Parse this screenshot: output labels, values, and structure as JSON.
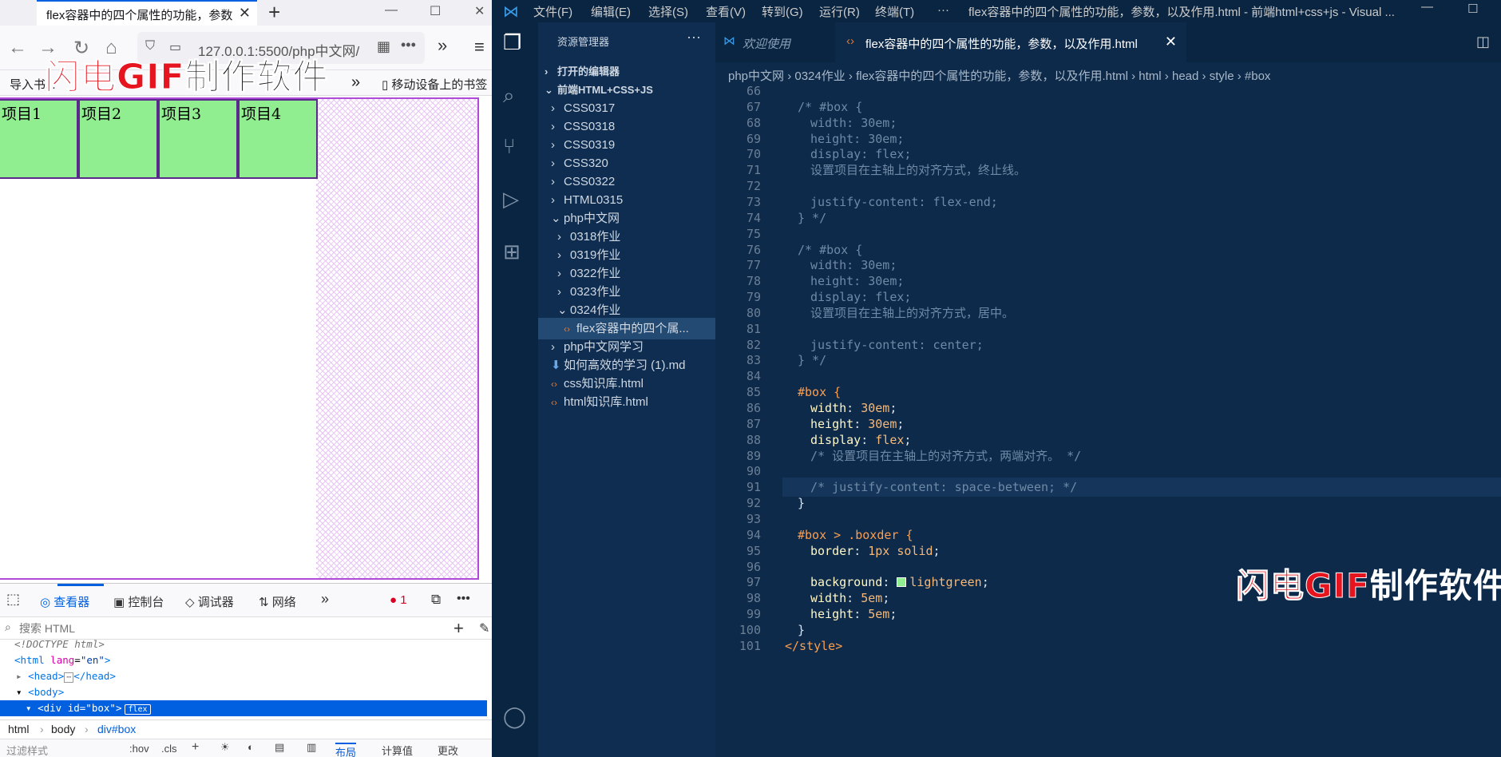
{
  "browser": {
    "tab_title": "flex容器中的四个属性的功能，参数",
    "tab_close": "✕",
    "new_tab": "+",
    "url": "127.0.0.1:5500/php中文网/",
    "bookmarks_more": "»",
    "bookmark_mobile": "移动设备上的书签",
    "bookmarks_partial": "导入书...",
    "items": [
      "项目1",
      "项目2",
      "项目3",
      "项目4"
    ]
  },
  "watermark": {
    "part1": "闪电GIF",
    "part2": "制作软件"
  },
  "devtools": {
    "tabs": [
      "查看器",
      "控制台",
      "调试器",
      "网络"
    ],
    "error_count": "1",
    "search_placeholder": "搜索 HTML",
    "tree": {
      "doctype": "<!DOCTYPE html>",
      "html_tag": "html",
      "html_attr": "lang",
      "html_val": "\"en\"",
      "head": "head",
      "body": "body",
      "div_tag": "div",
      "div_attr": "id",
      "div_val": "\"box\"",
      "flex_badge": "flex"
    },
    "crumbs": [
      "html",
      "body",
      "div#box"
    ],
    "bottom": {
      "filter": "过滤样式",
      "hov": ":hov",
      "cls": ".cls",
      "layout": "布局",
      "computed": "计算值",
      "changes": "更改"
    }
  },
  "vscode": {
    "menus": [
      "文件(F)",
      "编辑(E)",
      "选择(S)",
      "查看(V)",
      "转到(G)",
      "运行(R)",
      "终端(T)",
      "···"
    ],
    "title": "flex容器中的四个属性的功能，参数，以及作用.html - 前端html+css+js - Visual ...",
    "sidebar": {
      "header": "资源管理器",
      "sec_open": "打开的编辑器",
      "sec_project": "前端HTML+CSS+JS",
      "items": [
        {
          "label": "CSS0317",
          "depth": 1,
          "kind": "folder",
          "open": false
        },
        {
          "label": "CSS0318",
          "depth": 1,
          "kind": "folder",
          "open": false
        },
        {
          "label": "CSS0319",
          "depth": 1,
          "kind": "folder",
          "open": false
        },
        {
          "label": "CSS320",
          "depth": 1,
          "kind": "folder",
          "open": false
        },
        {
          "label": "CSS0322",
          "depth": 1,
          "kind": "folder",
          "open": false
        },
        {
          "label": "HTML0315",
          "depth": 1,
          "kind": "folder",
          "open": false
        },
        {
          "label": "php中文网",
          "depth": 1,
          "kind": "folder",
          "open": true
        },
        {
          "label": "0318作业",
          "depth": 2,
          "kind": "folder",
          "open": false
        },
        {
          "label": "0319作业",
          "depth": 2,
          "kind": "folder",
          "open": false
        },
        {
          "label": "0322作业",
          "depth": 2,
          "kind": "folder",
          "open": false
        },
        {
          "label": "0323作业",
          "depth": 2,
          "kind": "folder",
          "open": false
        },
        {
          "label": "0324作业",
          "depth": 2,
          "kind": "folder",
          "open": true
        },
        {
          "label": "flex容器中的四个属...",
          "depth": 3,
          "kind": "html",
          "active": true
        },
        {
          "label": "php中文网学习",
          "depth": 1,
          "kind": "folder",
          "open": false
        },
        {
          "label": "如何高效的学习 (1).md",
          "depth": 1,
          "kind": "md"
        },
        {
          "label": "css知识库.html",
          "depth": 1,
          "kind": "html"
        },
        {
          "label": "html知识库.html",
          "depth": 1,
          "kind": "html"
        }
      ]
    },
    "tabs": {
      "welcome": "欢迎使用",
      "file": "flex容器中的四个属性的功能，参数，以及作用.html"
    },
    "breadcrumbs": [
      "php中文网",
      "0324作业",
      "flex容器中的四个属性的功能，参数，以及作用.html",
      "html",
      "head",
      "style",
      "#box"
    ],
    "current_line": 91,
    "code": [
      {
        "n": "66",
        "t": ""
      },
      {
        "n": "67",
        "t": "/* #box {",
        "k": "com",
        "i": 0
      },
      {
        "n": "68",
        "t": "width: 30em;",
        "k": "com",
        "i": 1
      },
      {
        "n": "69",
        "t": "height: 30em;",
        "k": "com",
        "i": 1
      },
      {
        "n": "70",
        "t": "display: flex;",
        "k": "com",
        "i": 1
      },
      {
        "n": "71",
        "t": "设置项目在主轴上的对齐方式，终止线。",
        "k": "com",
        "i": 1
      },
      {
        "n": "72",
        "t": ""
      },
      {
        "n": "73",
        "t": "justify-content: flex-end;",
        "k": "com",
        "i": 1
      },
      {
        "n": "74",
        "t": "} */",
        "k": "com",
        "i": 0
      },
      {
        "n": "75",
        "t": ""
      },
      {
        "n": "76",
        "t": "/* #box {",
        "k": "com",
        "i": 0
      },
      {
        "n": "77",
        "t": "width: 30em;",
        "k": "com",
        "i": 1
      },
      {
        "n": "78",
        "t": "height: 30em;",
        "k": "com",
        "i": 1
      },
      {
        "n": "79",
        "t": "display: flex;",
        "k": "com",
        "i": 1
      },
      {
        "n": "80",
        "t": "设置项目在主轴上的对齐方式，居中。",
        "k": "com",
        "i": 1
      },
      {
        "n": "81",
        "t": ""
      },
      {
        "n": "82",
        "t": "justify-content: center;",
        "k": "com",
        "i": 1
      },
      {
        "n": "83",
        "t": "} */",
        "k": "com",
        "i": 0
      },
      {
        "n": "84",
        "t": ""
      },
      {
        "n": "85",
        "t": "#box {",
        "k": "sel",
        "i": 0
      },
      {
        "n": "86",
        "p": "width",
        "v": "30em",
        "i": 1
      },
      {
        "n": "87",
        "p": "height",
        "v": "30em",
        "i": 1
      },
      {
        "n": "88",
        "p": "display",
        "v": "flex",
        "i": 1
      },
      {
        "n": "89",
        "t": "/* 设置项目在主轴上的对齐方式，两端对齐。 */",
        "k": "com",
        "i": 1
      },
      {
        "n": "90",
        "t": ""
      },
      {
        "n": "91",
        "t": "/* justify-content: space-between; */",
        "k": "com",
        "i": 1
      },
      {
        "n": "92",
        "t": "}",
        "k": "punc",
        "i": 0
      },
      {
        "n": "93",
        "t": ""
      },
      {
        "n": "94",
        "t": "#box > .boxder {",
        "k": "sel",
        "i": 0
      },
      {
        "n": "95",
        "p": "border",
        "v": "1px solid",
        "i": 1
      },
      {
        "n": "96",
        "t": ""
      },
      {
        "n": "97",
        "p": "background",
        "v": "lightgreen",
        "i": 1,
        "swatch": "#90ee90"
      },
      {
        "n": "98",
        "p": "width",
        "v": "5em",
        "i": 1
      },
      {
        "n": "99",
        "p": "height",
        "v": "5em",
        "i": 1
      },
      {
        "n": "100",
        "t": "}",
        "k": "punc",
        "i": 0
      },
      {
        "n": "101",
        "t": "</style>",
        "k": "tagc",
        "i": -1
      }
    ]
  },
  "colors": {
    "accent": "#0060df",
    "item_green": "#90ee90",
    "vs_bg": "#0d2a4a",
    "box_border": "#b04bd8"
  }
}
